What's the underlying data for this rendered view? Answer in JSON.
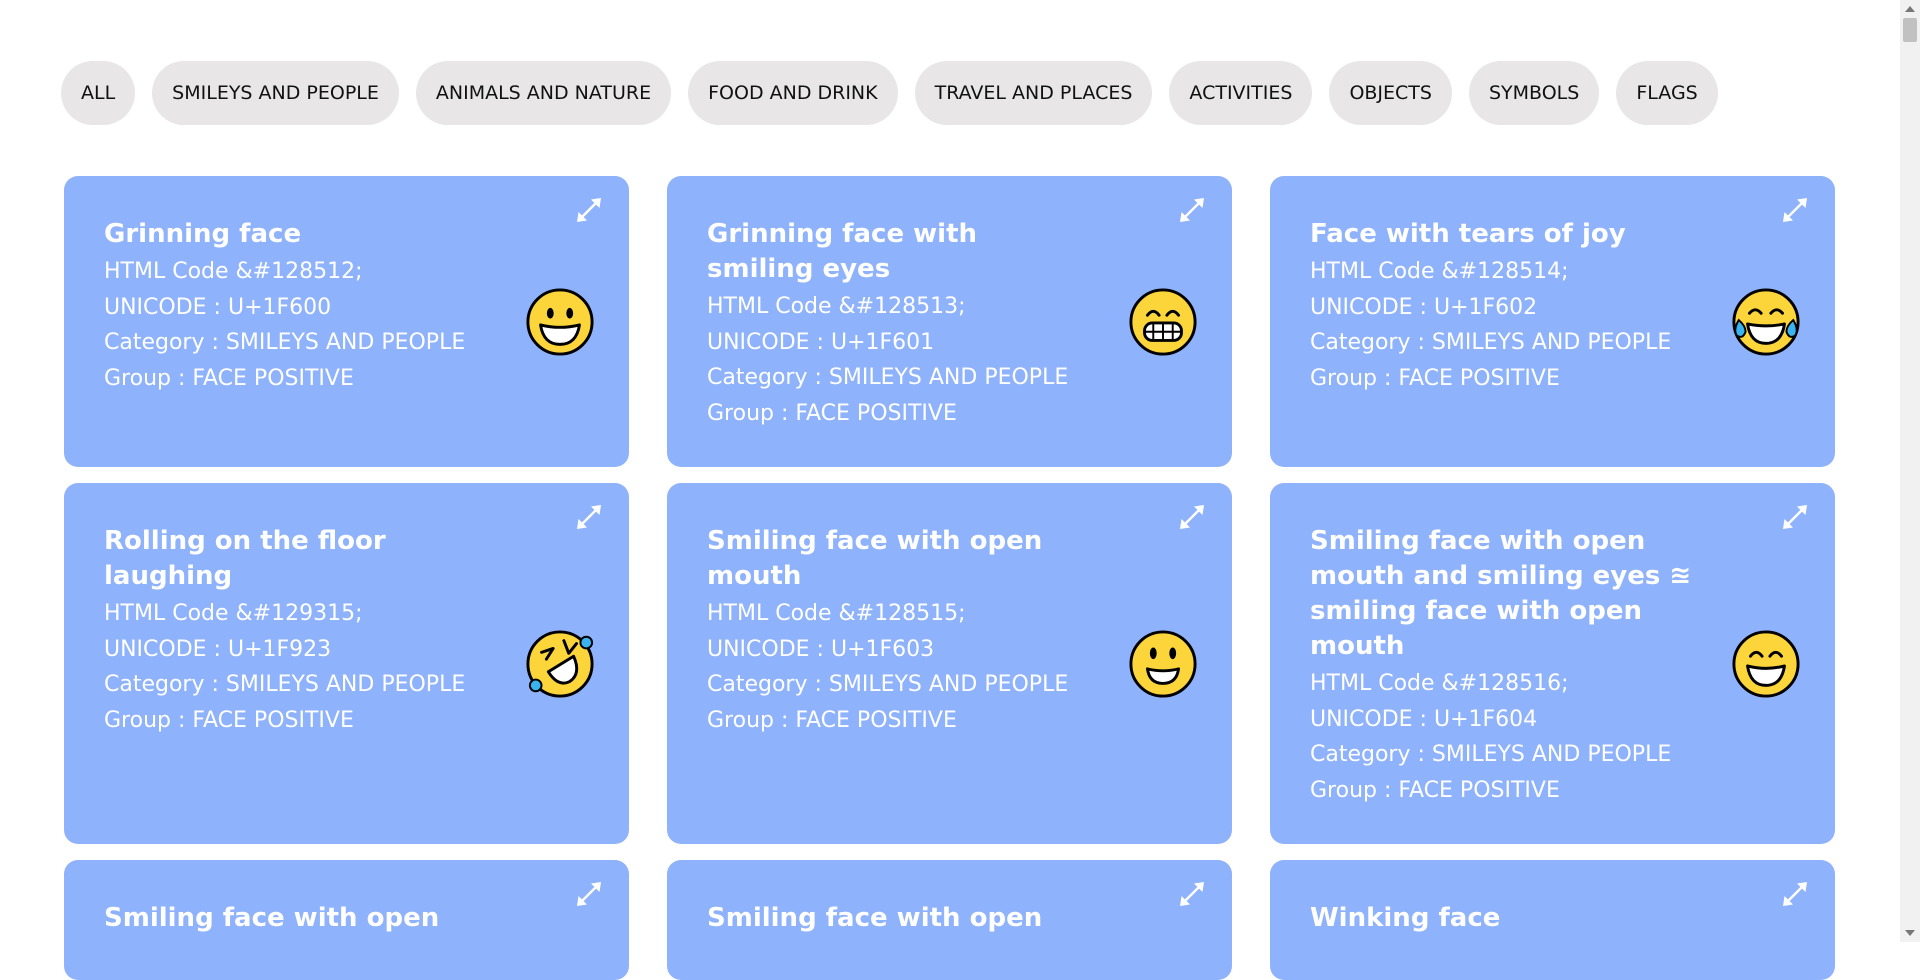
{
  "filters": [
    "ALL",
    "SMILEYS AND PEOPLE",
    "ANIMALS AND NATURE",
    "FOOD AND DRINK",
    "TRAVEL AND PLACES",
    "ACTIVITIES",
    "OBJECTS",
    "SYMBOLS",
    "FLAGS"
  ],
  "cards": [
    {
      "name": "Grinning face",
      "html_code": "HTML Code &#128512;",
      "unicode": "UNICODE : U+1F600",
      "category": "Category : SMILEYS AND PEOPLE",
      "group": "Group : FACE POSITIVE",
      "icon": "grinning-face-emoji"
    },
    {
      "name": "Grinning face with smiling eyes",
      "html_code": "HTML Code &#128513;",
      "unicode": "UNICODE : U+1F601",
      "category": "Category : SMILEYS AND PEOPLE",
      "group": "Group : FACE POSITIVE",
      "icon": "beaming-face-emoji"
    },
    {
      "name": "Face with tears of joy",
      "html_code": "HTML Code &#128514;",
      "unicode": "UNICODE : U+1F602",
      "category": "Category : SMILEYS AND PEOPLE",
      "group": "Group : FACE POSITIVE",
      "icon": "tears-of-joy-emoji"
    },
    {
      "name": "Rolling on the floor laughing",
      "html_code": "HTML Code &#129315;",
      "unicode": "UNICODE : U+1F923",
      "category": "Category : SMILEYS AND PEOPLE",
      "group": "Group : FACE POSITIVE",
      "icon": "rofl-emoji"
    },
    {
      "name": "Smiling face with open mouth",
      "html_code": "HTML Code &#128515;",
      "unicode": "UNICODE : U+1F603",
      "category": "Category : SMILEYS AND PEOPLE",
      "group": "Group : FACE POSITIVE",
      "icon": "open-mouth-smile-emoji"
    },
    {
      "name": "Smiling face with open mouth and smiling eyes ≊ smiling face with open mouth",
      "html_code": "HTML Code &#128516;",
      "unicode": "UNICODE : U+1F604",
      "category": "Category : SMILEYS AND PEOPLE",
      "group": "Group : FACE POSITIVE",
      "icon": "grinning-smiling-eyes-emoji"
    },
    {
      "name": "Smiling face with open",
      "icon": ""
    },
    {
      "name": "Smiling face with open",
      "icon": ""
    },
    {
      "name": "Winking face",
      "icon": ""
    }
  ],
  "colors": {
    "card_bg": "#8fb2fc",
    "chip_bg": "#e8e6e6",
    "emoji_yellow": "#fcd53a",
    "tear_blue": "#3ab4f0"
  }
}
